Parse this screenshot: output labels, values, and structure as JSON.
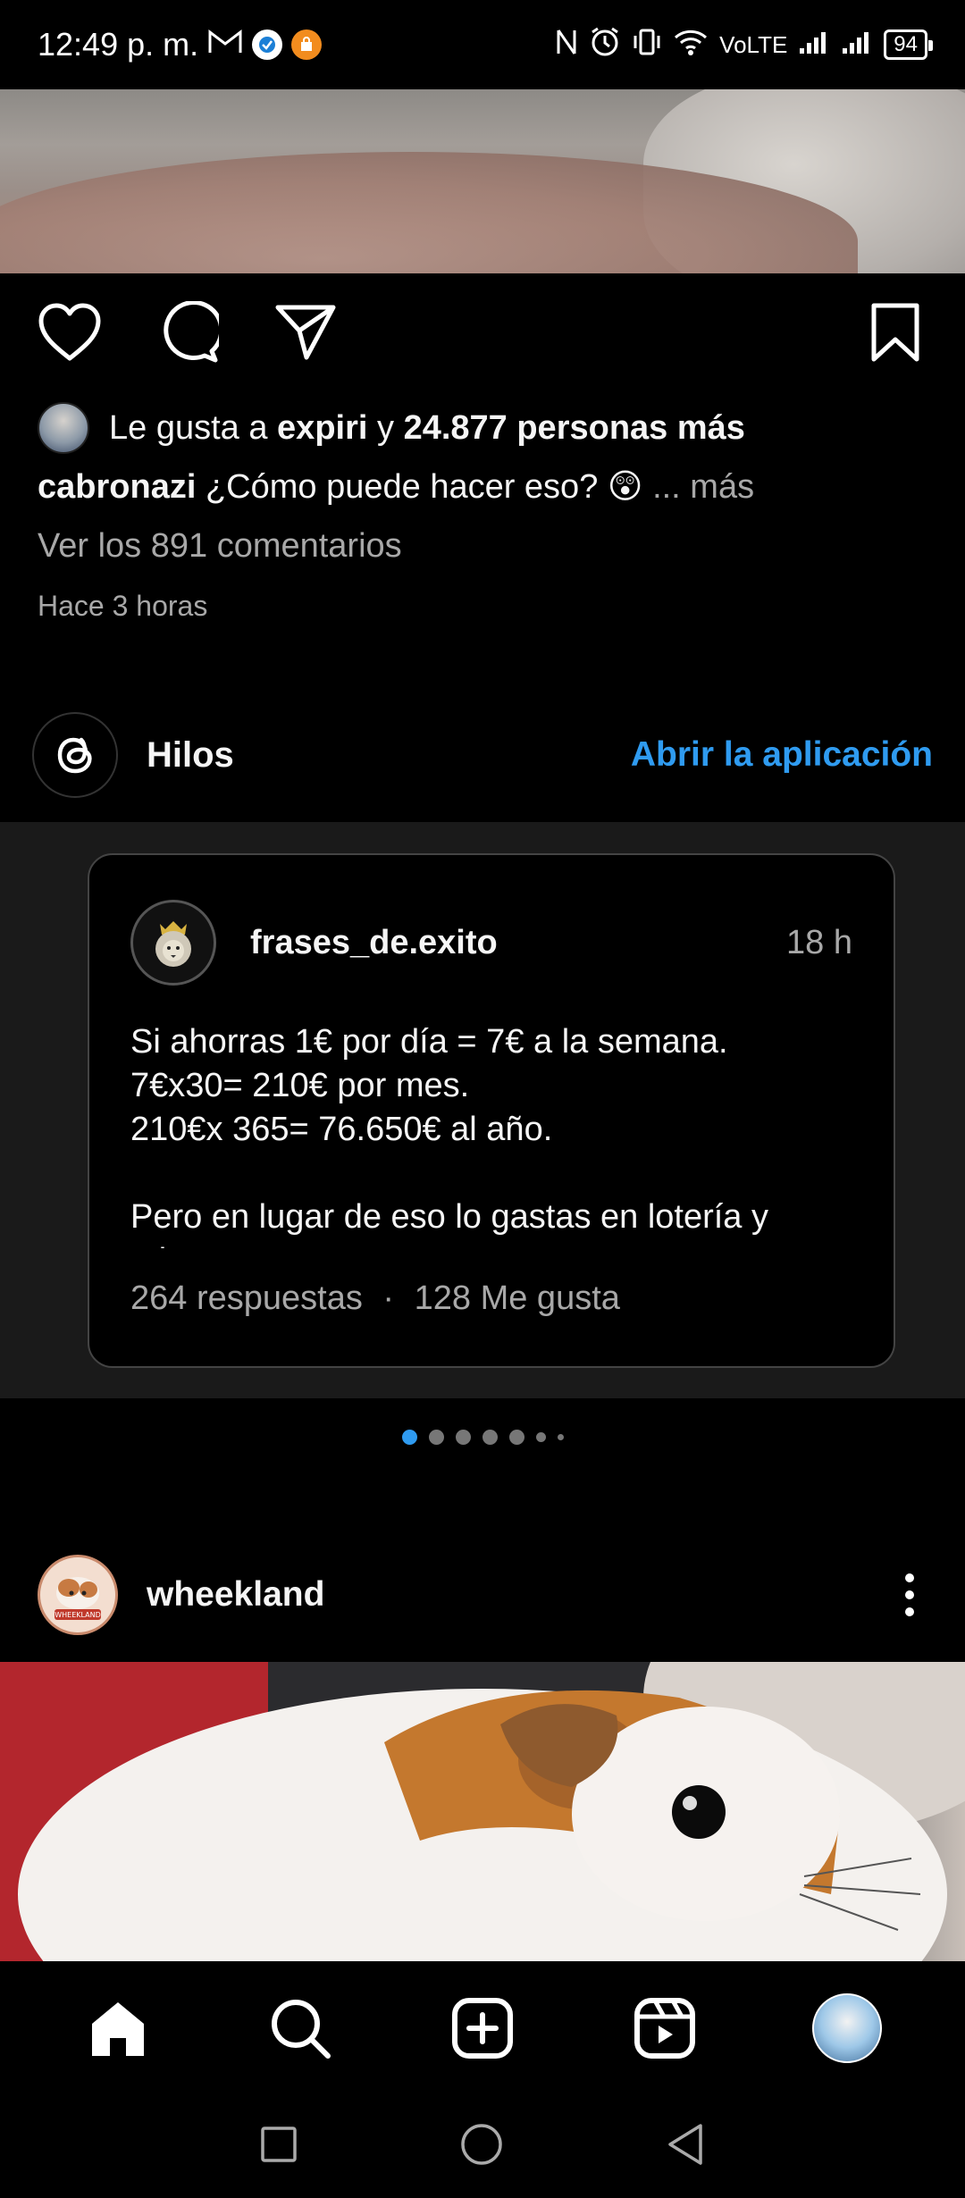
{
  "status_bar": {
    "time": "12:49 p. m.",
    "network": "VoLTE",
    "battery": "94"
  },
  "post1": {
    "likes": {
      "prefix": "Le gusta a",
      "liker": "expiri",
      "joiner": "y",
      "others": "24.877 personas más"
    },
    "caption": {
      "username": "cabronazi",
      "text": "¿Cómo puede hacer eso? 😲",
      "more": "... más"
    },
    "comments_link": "Ver los 891 comentarios",
    "time_ago": "Hace 3 horas"
  },
  "threads": {
    "label": "Hilos",
    "open_app": "Abrir la aplicación",
    "card": {
      "username": "frases_de.exito",
      "time": "18 h",
      "lines": [
        "Si ahorras 1€ por día = 7€ a la semana.",
        "7€x30= 210€ por mes.",
        "210€x 365= 76.650€ al año.",
        "",
        "Pero en lugar de eso lo gastas en lotería y",
        "tabaco."
      ],
      "replies": "264 respuestas",
      "separator": "·",
      "likes": "128 Me gusta"
    },
    "carousel": {
      "total": 7,
      "active": 1
    }
  },
  "post2": {
    "username": "wheekland",
    "avatar_text": "WHEEKLAND"
  },
  "colors": {
    "accent": "#2f9bf0",
    "muted": "#a8a8a8",
    "background": "#000000",
    "panel": "#1a1a1a"
  }
}
